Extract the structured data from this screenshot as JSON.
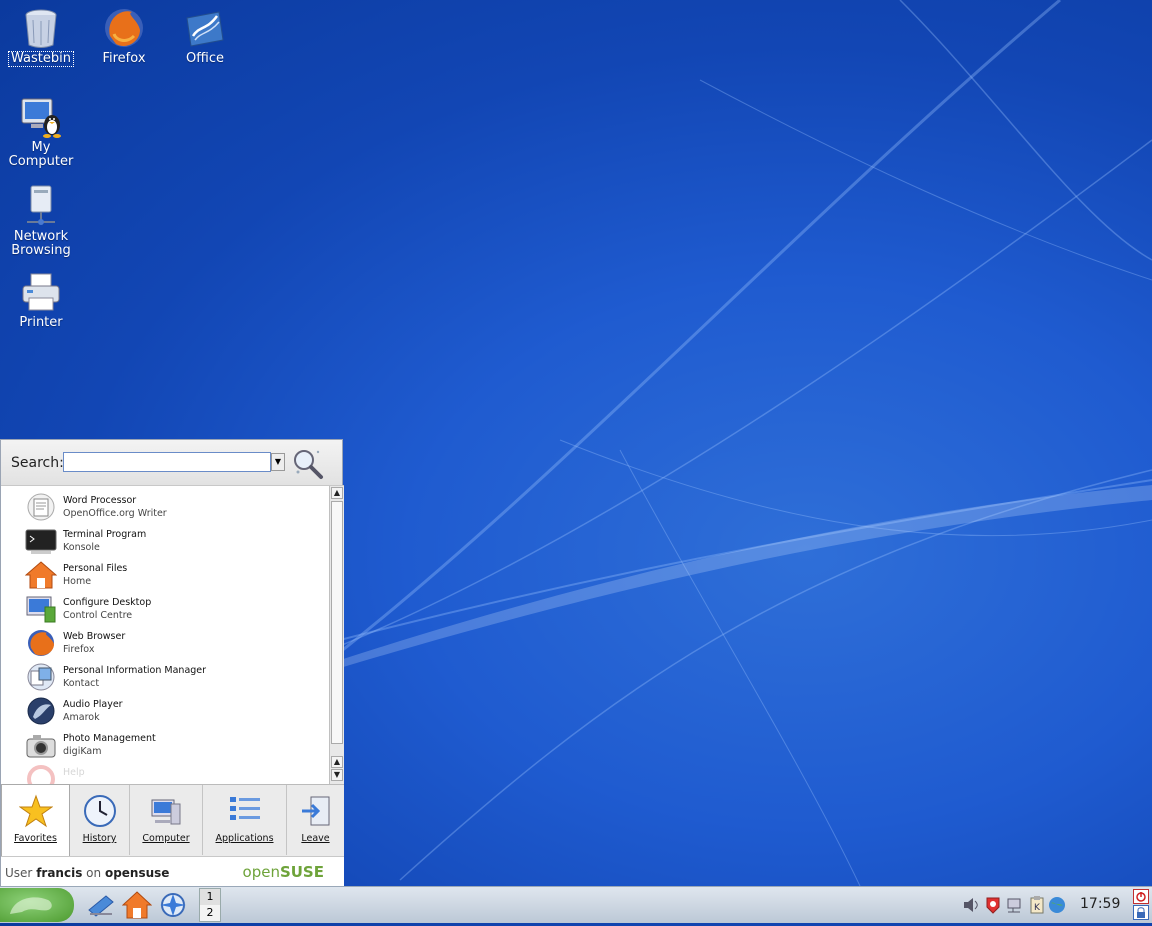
{
  "desktop": {
    "icons": [
      {
        "label": "Wastebin"
      },
      {
        "label": "Firefox"
      },
      {
        "label": "Office"
      },
      {
        "label": "My Computer"
      },
      {
        "label": "Network Browsing"
      },
      {
        "label": "Printer"
      }
    ]
  },
  "menu": {
    "search_label": "Search:",
    "search_value": "",
    "favorites": [
      {
        "title": "Word Processor",
        "subtitle": "OpenOffice.org Writer"
      },
      {
        "title": "Terminal Program",
        "subtitle": "Konsole"
      },
      {
        "title": "Personal Files",
        "subtitle": "Home"
      },
      {
        "title": "Configure Desktop",
        "subtitle": "Control Centre"
      },
      {
        "title": "Web Browser",
        "subtitle": "Firefox"
      },
      {
        "title": "Personal Information Manager",
        "subtitle": "Kontact"
      },
      {
        "title": "Audio Player",
        "subtitle": "Amarok"
      },
      {
        "title": "Photo Management",
        "subtitle": "digiKam"
      },
      {
        "title": "Help",
        "subtitle": ""
      }
    ],
    "tabs": [
      {
        "label": "Favorites"
      },
      {
        "label": "History"
      },
      {
        "label": "Computer"
      },
      {
        "label": "Applications"
      },
      {
        "label": "Leave"
      }
    ],
    "footer": {
      "user_prefix": "User",
      "user": "francis",
      "on": "on",
      "host": "opensuse",
      "brand_prefix": "open",
      "brand_suffix": "SUSE"
    }
  },
  "taskbar": {
    "pager": [
      "1",
      "2"
    ],
    "clock": "17:59"
  }
}
